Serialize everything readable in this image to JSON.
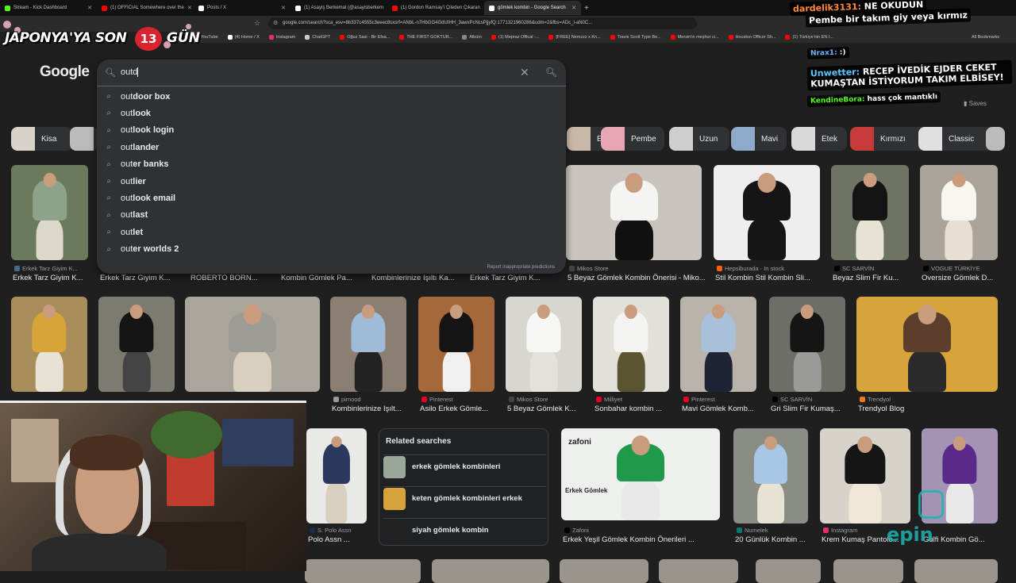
{
  "tabs": [
    {
      "label": "Stream - Kick Dashboard",
      "color": "#53fc18",
      "active": false
    },
    {
      "label": "(1) OFFICIAL Somewhere over the",
      "color": "#ff0000",
      "active": false
    },
    {
      "label": "Posts / X",
      "color": "#ffffff",
      "active": false
    },
    {
      "label": "(1) Asayiş Berkemal (@asayisberkem",
      "color": "#ffffff",
      "active": false
    },
    {
      "label": "(1) Gordon Ramsay'i Çileden Çıkaran",
      "color": "#ff0000",
      "active": false
    },
    {
      "label": "gömlek kombin - Google Search",
      "color": "#ffffff",
      "active": true
    }
  ],
  "omnibox": {
    "url": "google.com/search?sca_esv=8b337c4555c3eeec8sxsrf=ANbL-n7HbGG4GdUIHH_3awxPcNcsPjjyfQ:1771321960286&udm=2&fbs=ADc_l-aN0C..."
  },
  "bookmarks": [
    {
      "label": "YouTube",
      "color": "#ff0000"
    },
    {
      "label": "(4) Home / X",
      "color": "#ffffff"
    },
    {
      "label": "Instagram",
      "color": "#e1306c"
    },
    {
      "label": "ChatGPT",
      "color": "#cccccc"
    },
    {
      "label": "Oğuz Sasi - Bir Efsa...",
      "color": "#ff0000"
    },
    {
      "label": "THE FIRST GOKTUR...",
      "color": "#ff0000"
    },
    {
      "label": "Albüm",
      "color": "#888888"
    },
    {
      "label": "(1) Mepraz Offical -...",
      "color": "#ff0000"
    },
    {
      "label": "[FREE] Nemzzz x Kn...",
      "color": "#ff0000"
    },
    {
      "label": "Travis Scott Type Be...",
      "color": "#ff0000"
    },
    {
      "label": "Mersin'in meşhur ci...",
      "color": "#ff0000"
    },
    {
      "label": "Houston Officer Sh...",
      "color": "#ff0000"
    },
    {
      "label": "(1) Türkiye'nin EN I...",
      "color": "#ff0000"
    }
  ],
  "all_bookmarks": "All Bookmarks",
  "banner": {
    "text": "JAPONYA'YA SON",
    "number": "13",
    "suffix": "GÜN"
  },
  "google_logo": "Google",
  "search": {
    "value": "outd",
    "suggestions": [
      {
        "typed": "out",
        "rest": "door box"
      },
      {
        "typed": "out",
        "rest": "look"
      },
      {
        "typed": "out",
        "rest": "look login"
      },
      {
        "typed": "out",
        "rest": "lander"
      },
      {
        "typed": "out",
        "rest": "er banks"
      },
      {
        "typed": "out",
        "rest": "lier"
      },
      {
        "typed": "out",
        "rest": "look email"
      },
      {
        "typed": "out",
        "rest": "last"
      },
      {
        "typed": "out",
        "rest": "let"
      },
      {
        "typed": "out",
        "rest": "er worlds 2"
      }
    ],
    "report_text": "Report inappropriate predictions"
  },
  "chips": [
    {
      "label": "Kisa",
      "color": "#d8d2c8"
    },
    {
      "label": "Elbise",
      "color": "#c9b9a9"
    },
    {
      "label": "Pembe",
      "color": "#e6a6b3"
    },
    {
      "label": "Uzun",
      "color": "#cfcfcf"
    },
    {
      "label": "Mavi",
      "color": "#8fa9c9"
    },
    {
      "label": "Etek",
      "color": "#d9d9d9"
    },
    {
      "label": "Kırmızı",
      "color": "#c73a3a"
    },
    {
      "label": "Classic",
      "color": "#e0e0e0"
    }
  ],
  "row1_captions": [
    {
      "source": "Erkek Tarz Giyim K...",
      "title": "Erkek Tarz Giyim K..."
    },
    {
      "source": "",
      "title": "Erkek Tarz Giyim K..."
    },
    {
      "source": "",
      "title": "ROBERTO BORN..."
    },
    {
      "source": "",
      "title": "Kombin Gömlek Pa..."
    },
    {
      "source": "",
      "title": "Kombinlerinize Işıltı Ka..."
    },
    {
      "source": "",
      "title": "Erkek Tarz Giyim K..."
    },
    {
      "source": "Mikos Store",
      "title": "5 Beyaz Gömlek Kombin Önerisi - Miko..."
    },
    {
      "source": "Hepsiburada · In stock",
      "title": "Stil Kombin Stil Kombin Sli..."
    },
    {
      "source": "SC SARVİN",
      "title": "Beyaz Slim Fir Ku..."
    },
    {
      "source": "VOGUE TÜRKİYE",
      "title": "Oversize Gömlek D..."
    }
  ],
  "row2_captions": [
    {
      "source": "pimood",
      "title": "Kombinlerinize Işılt..."
    },
    {
      "source": "Pinterest",
      "title": "Asilo Erkek Gömle..."
    },
    {
      "source": "Mikos Store",
      "title": "5 Beyaz Gömlek K..."
    },
    {
      "source": "Milliyet",
      "title": "Sonbahar kombin ..."
    },
    {
      "source": "Pinterest",
      "title": "Mavi Gömlek Komb..."
    },
    {
      "source": "SC SARVİN",
      "title": "Gri Slim Fir Kumaş..."
    },
    {
      "source": "Trendyol",
      "title": "Trendyol Blog"
    }
  ],
  "row3_captions": [
    {
      "source": "S. Polo Assn",
      "title": "Polo Assn ..."
    },
    {
      "source": "Zafoni",
      "title": "Erkek Yeşil Gömlek Kombin Önerileri ..."
    },
    {
      "source": "Numelek",
      "title": "20 Günlük Kombin ..."
    },
    {
      "source": "Instagram",
      "title": "Krem Kumaş Pantolo..."
    },
    {
      "source": "",
      "title": "Gülfi Kombin Gö..."
    }
  ],
  "related": {
    "title": "Related searches",
    "items": [
      {
        "bold": "erkek",
        "rest": " gömlek kombinleri"
      },
      {
        "bold": "keten",
        "rest": " gömlek kombinleri erkek"
      },
      {
        "bold": "siyah",
        "rest": " gömlek kombin"
      }
    ]
  },
  "zafoni": {
    "brand": "zafoni",
    "label": "Erkek Gömlek"
  },
  "saves": "Saves",
  "chat": [
    {
      "user": "dardelik3131:",
      "msg": " NE OKUDUN",
      "color": "#ffffff"
    },
    {
      "user": "",
      "msg": "Pembe bir takım giy veya kırmız",
      "color": "#ffffff"
    },
    {
      "user": "Nrax1:",
      "msg": " :)",
      "color": "#ffffff"
    },
    {
      "user": "Unwetter:",
      "msg": " RECEP İVEDİK EJDER CEKET KUMAŞTAN İSTİYORUM TAKIM ELBİSEY!",
      "color": "#ffffff"
    },
    {
      "user": "KendineBora:",
      "msg": " hass çok mantıklı",
      "color": "#ffffff"
    }
  ],
  "sponsor": "epin"
}
